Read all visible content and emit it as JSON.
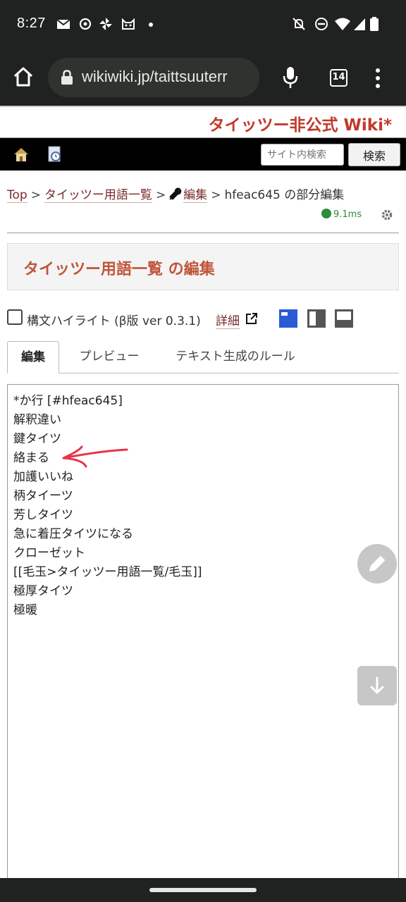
{
  "status_bar": {
    "time": "8:27",
    "left_icons": [
      "mail-icon",
      "threads-icon",
      "pinwheel-icon",
      "cat-icon",
      "dot-icon"
    ],
    "right_icons": [
      "notifications-off-icon",
      "dnd-icon",
      "wifi-icon",
      "signal-icon",
      "battery-icon"
    ]
  },
  "browser": {
    "url": "wikiwiki.jp/taittsuuterr",
    "tab_count": "14"
  },
  "site": {
    "title": "タイッツー非公式 Wiki*",
    "search_placeholder": "サイト内検索",
    "search_button": "検索"
  },
  "breadcrumb": {
    "items": [
      "Top",
      "タイッツー用語一覧",
      "編集"
    ],
    "current": "hfeac645 の部分編集",
    "separator": ">"
  },
  "timing": "9.1ms",
  "page_heading": "タイッツー用語一覧 の編集",
  "syntax_highlight": {
    "label": "構文ハイライト (β版 ver 0.3.1)",
    "detail_link": "詳細",
    "checked": false
  },
  "tabs": [
    {
      "label": "編集",
      "active": true
    },
    {
      "label": "プレビュー",
      "active": false
    },
    {
      "label": "テキスト生成のルール",
      "active": false
    }
  ],
  "editor_lines": [
    "*か行 [#hfeac645]",
    "解釈違い",
    "鍵タイツ",
    "絡まる",
    "加護いいね",
    "柄タイーツ",
    "芳しタイツ",
    "急に着圧タイツになる",
    "クローゼット",
    "[[毛玉>タイッツー用語一覧/毛玉]]",
    "極厚タイツ",
    "極暖"
  ],
  "colors": {
    "accent": "#c0392b",
    "annotation_arrow": "#e8334a",
    "timing_green": "#2e8b3a",
    "layout_blue": "#2a5bd7"
  }
}
